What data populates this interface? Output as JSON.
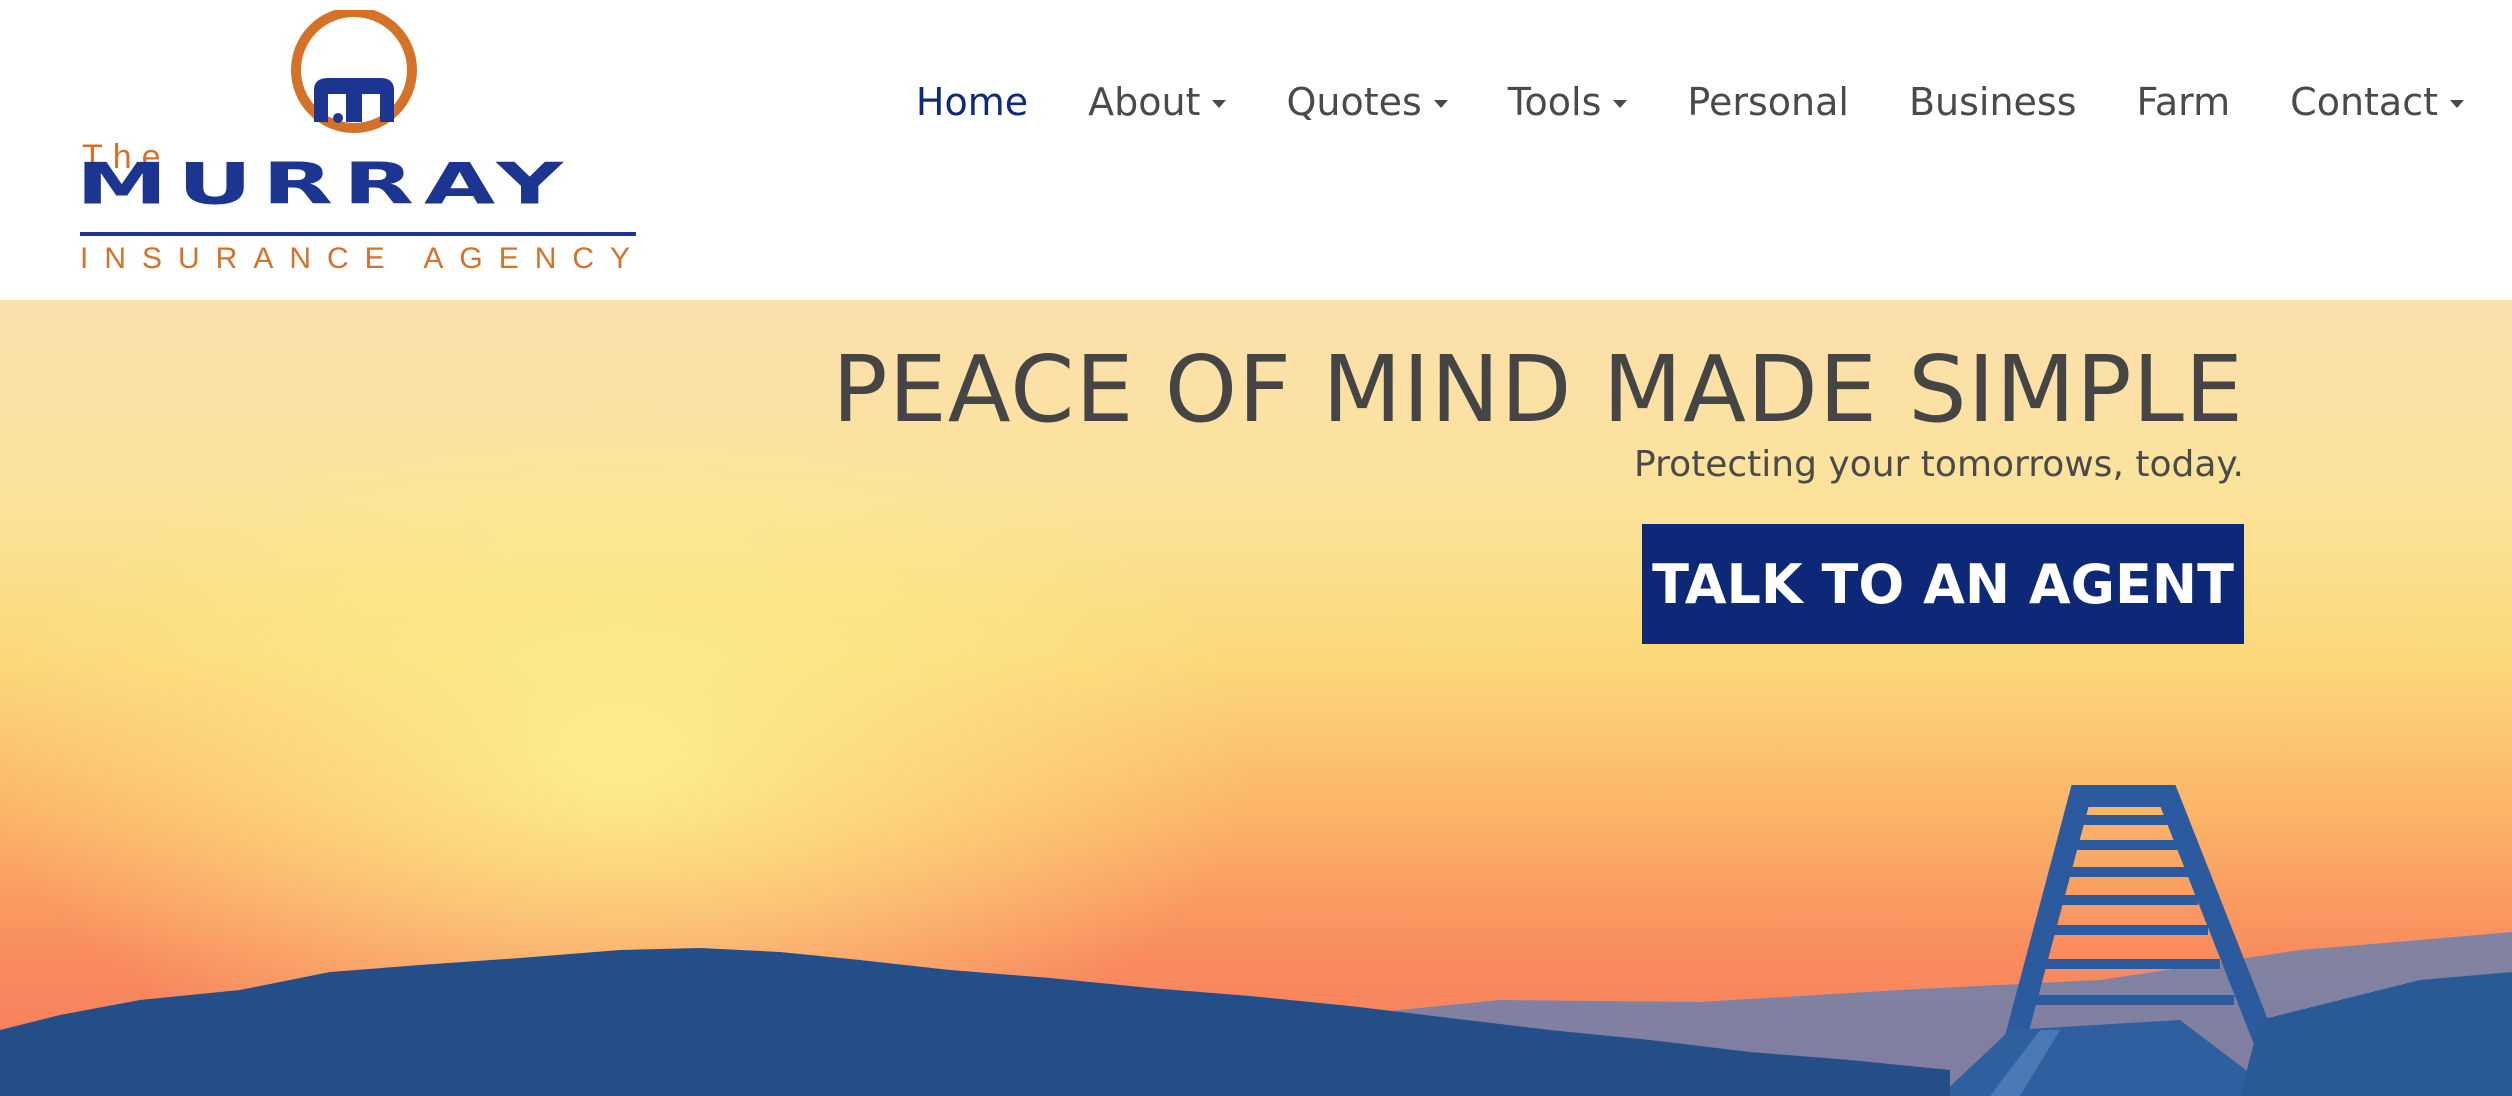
{
  "brand": {
    "the": "The",
    "name": "MURRAY",
    "tagline": "INSURANCE AGENCY"
  },
  "nav": {
    "items": [
      {
        "label": "Home",
        "dropdown": false,
        "active": true
      },
      {
        "label": "About",
        "dropdown": true,
        "active": false
      },
      {
        "label": "Quotes",
        "dropdown": true,
        "active": false
      },
      {
        "label": "Tools",
        "dropdown": true,
        "active": false
      },
      {
        "label": "Personal",
        "dropdown": false,
        "active": false
      },
      {
        "label": "Business",
        "dropdown": false,
        "active": false
      },
      {
        "label": "Farm",
        "dropdown": false,
        "active": false
      },
      {
        "label": "Contact",
        "dropdown": true,
        "active": false
      }
    ]
  },
  "hero": {
    "title": "PEACE OF MIND MADE SIMPLE",
    "subtitle": "Protecting your tomorrows, today.",
    "cta_label": "TALK TO AN AGENT"
  },
  "colors": {
    "brand_blue": "#0e2878",
    "brand_orange": "#d4722a",
    "nav_text": "#4a4a4a",
    "nav_active": "#0f2a7a"
  }
}
